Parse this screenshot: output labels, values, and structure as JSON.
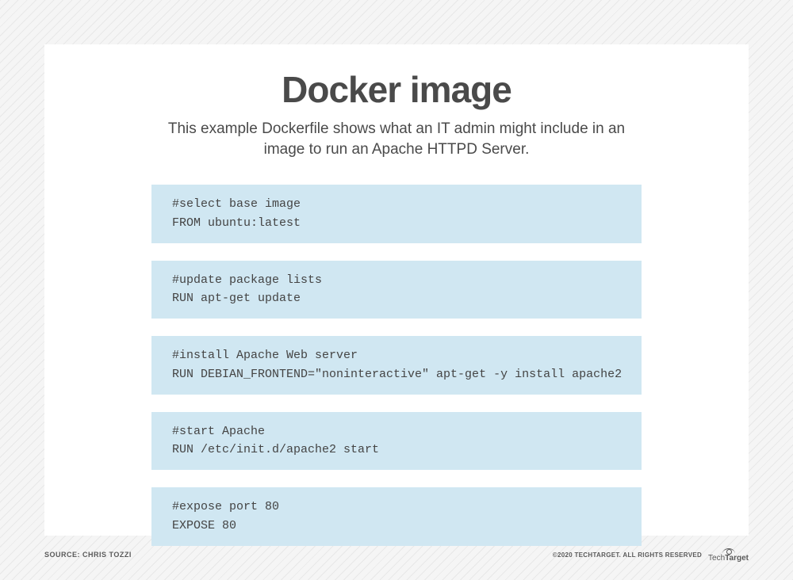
{
  "header": {
    "title": "Docker image",
    "subtitle": "This example Dockerfile shows what an IT admin might include in an image to run an Apache HTTPD Server."
  },
  "blocks": [
    {
      "code": "#select base image\nFROM ubuntu:latest"
    },
    {
      "code": "#update package lists\nRUN apt-get update"
    },
    {
      "code": "#install Apache Web server\nRUN DEBIAN_FRONTEND=\"noninteractive\" apt-get -y install apache2"
    },
    {
      "code": "#start Apache\nRUN /etc/init.d/apache2 start"
    },
    {
      "code": "#expose port 80\nEXPOSE 80"
    }
  ],
  "footer": {
    "source": "SOURCE: CHRIS TOZZI",
    "rights": "©2020 TECHTARGET. ALL RIGHTS RESERVED",
    "brand_prefix": "Tech",
    "brand_suffix": "Target"
  }
}
